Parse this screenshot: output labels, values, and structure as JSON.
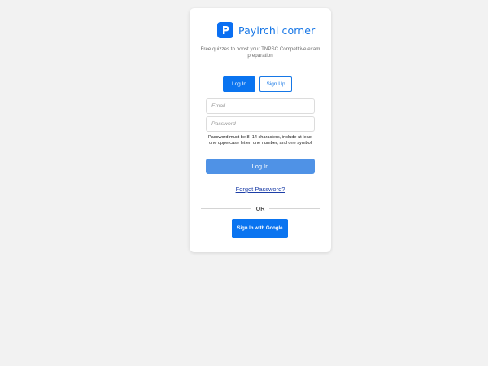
{
  "brand": {
    "logo_letter": "P",
    "name": "Payirchi corner",
    "logo_color": "#0a6ff2"
  },
  "tagline": "Free quizzes to boost your TNPSC Competitive exam preparation",
  "tabs": [
    {
      "label": "Log In",
      "active": true
    },
    {
      "label": "Sign Up",
      "active": false
    }
  ],
  "form": {
    "email_placeholder": "Email",
    "email_value": "",
    "password_placeholder": "Password",
    "password_value": "",
    "password_hint": "Password must be 8–14 characters, include at least one uppercase letter, one number, and one symbol",
    "submit_label": "Log In"
  },
  "forgot_password_label": "Forgot Password?",
  "divider_label": "OR",
  "google_button_label": "Sign In with Google",
  "colors": {
    "accent": "#0a74f0",
    "submit": "#4f92e6",
    "background": "#f2f2f2"
  }
}
